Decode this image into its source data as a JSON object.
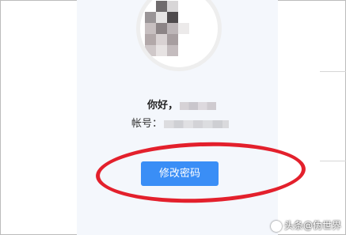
{
  "profile": {
    "greeting": "你好，",
    "account_label": "帐号："
  },
  "actions": {
    "change_password": "修改密码"
  },
  "watermark": {
    "text": "头条@伪世界"
  },
  "colors": {
    "button": "#3a8ef6",
    "annotation": "#e3202c",
    "panel": "#f4f7fc"
  }
}
